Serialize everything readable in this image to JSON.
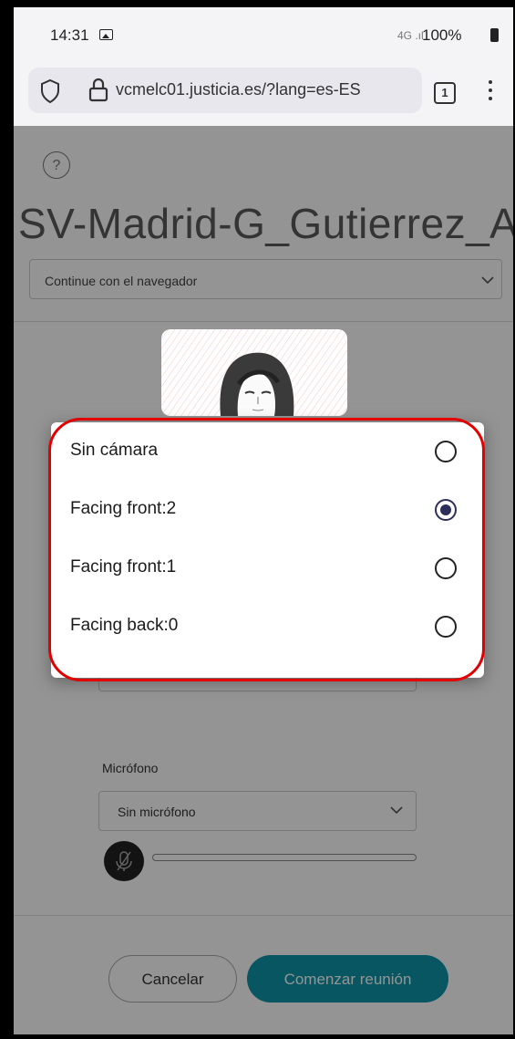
{
  "status_bar": {
    "time": "14:31",
    "network": "4G .ıl",
    "battery": "100%"
  },
  "browser": {
    "url": "vcmelc01.justicia.es/?lang=es-ES",
    "tab_count": "1"
  },
  "page": {
    "help_symbol": "?",
    "meeting_title": "SV-Madrid-G_Gutierrez_A...",
    "browser_option": "Continue con el navegador",
    "microphone_label": "Micrófono",
    "microphone_value": "Sin micrófono",
    "cancel_label": "Cancelar",
    "start_label": "Comenzar reunión"
  },
  "camera_dialog": {
    "options": [
      {
        "label": "Sin cámara",
        "selected": false
      },
      {
        "label": "Facing front:2",
        "selected": true
      },
      {
        "label": "Facing front:1",
        "selected": false
      },
      {
        "label": "Facing back:0",
        "selected": false
      }
    ]
  },
  "colors": {
    "accent": "#0d94a7",
    "highlight": "#e30000",
    "radio_selected": "#2e2e5a"
  }
}
